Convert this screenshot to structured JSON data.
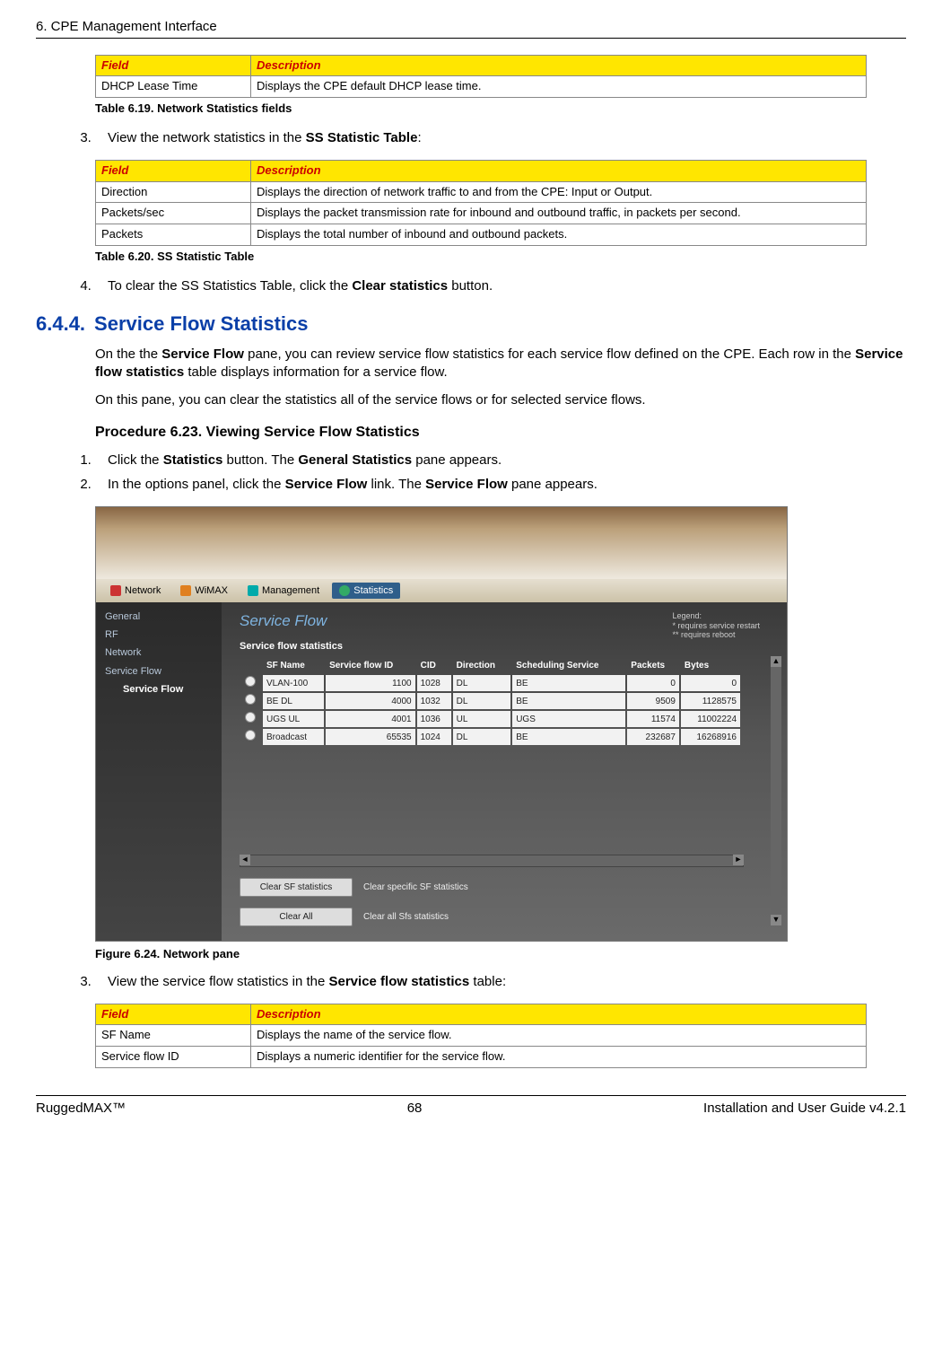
{
  "header": {
    "chapter": "6. CPE Management Interface"
  },
  "table619": {
    "h_field": "Field",
    "h_desc": "Description",
    "rows": [
      {
        "f": "DHCP Lease Time",
        "d": "Displays the CPE default DHCP lease time."
      }
    ],
    "caption": "Table 6.19. Network Statistics fields"
  },
  "step3": {
    "pre": "View the network statistics in the ",
    "bold": "SS Statistic Table",
    "post": ":"
  },
  "table620": {
    "h_field": "Field",
    "h_desc": "Description",
    "rows": [
      {
        "f": "Direction",
        "d": "Displays the direction of network traffic to and from the CPE: Input or Output."
      },
      {
        "f": "Packets/sec",
        "d": "Displays the packet transmission rate for inbound and outbound traffic, in packets per second."
      },
      {
        "f": "Packets",
        "d": "Displays the total number of inbound and outbound packets."
      }
    ],
    "caption": "Table 6.20. SS Statistic Table"
  },
  "step4": {
    "pre": "To clear the SS Statistics Table, click the ",
    "bold": "Clear statistics",
    "post": " button."
  },
  "section644": {
    "num": "6.4.4.",
    "title": "Service Flow Statistics",
    "p1": {
      "t0": "On the the ",
      "b0": "Service Flow",
      "t1": " pane, you can review service flow statistics for each service flow defined on the CPE. Each row in the ",
      "b1": "Service flow statistics",
      "t2": " table displays information for a service flow."
    },
    "p2": "On this pane, you can clear the statistics all of the service flows or for selected service flows."
  },
  "proc623": {
    "title": "Procedure 6.23. Viewing Service Flow Statistics",
    "s1": {
      "t0": "Click the ",
      "b0": "Statistics",
      "t1": " button. The ",
      "b1": "General Statistics",
      "t2": " pane appears."
    },
    "s2": {
      "t0": "In the options panel, click the ",
      "b0": "Service Flow",
      "t1": " link. The ",
      "b1": "Service Flow",
      "t2": " pane appears."
    },
    "s3": {
      "t0": "View the service flow statistics in the ",
      "b0": "Service flow statistics",
      "t1": " table:"
    }
  },
  "screenshot": {
    "tabs": {
      "network": "Network",
      "wimax": "WiMAX",
      "management": "Management",
      "statistics": "Statistics"
    },
    "side": {
      "general": "General",
      "rf": "RF",
      "network": "Network",
      "sf": "Service Flow",
      "sf_active": "Service Flow"
    },
    "title": "Service Flow",
    "legend": {
      "l0": "Legend:",
      "l1": "*  requires service restart",
      "l2": "** requires reboot"
    },
    "subhead": "Service flow statistics",
    "cols": {
      "sfname": "SF Name",
      "sfid": "Service flow ID",
      "cid": "CID",
      "dir": "Direction",
      "sched": "Scheduling Service",
      "packets": "Packets",
      "bytes": "Bytes"
    },
    "rows": [
      {
        "name": "VLAN-100",
        "sfid": "1100",
        "cid": "1028",
        "dir": "DL",
        "sched": "BE",
        "packets": "0",
        "bytes": "0"
      },
      {
        "name": "BE DL",
        "sfid": "4000",
        "cid": "1032",
        "dir": "DL",
        "sched": "BE",
        "packets": "9509",
        "bytes": "1128575"
      },
      {
        "name": "UGS UL",
        "sfid": "4001",
        "cid": "1036",
        "dir": "UL",
        "sched": "UGS",
        "packets": "11574",
        "bytes": "11002224"
      },
      {
        "name": "Broadcast",
        "sfid": "65535",
        "cid": "1024",
        "dir": "DL",
        "sched": "BE",
        "packets": "232687",
        "bytes": "16268916"
      }
    ],
    "btn1": "Clear SF statistics",
    "btn1label": "Clear specific SF statistics",
    "btn2": "Clear All",
    "btn2label": "Clear all Sfs statistics"
  },
  "figcap": "Figure 6.24. Network pane",
  "table621prefix": {
    "h_field": "Field",
    "h_desc": "Description",
    "rows": [
      {
        "f": "SF Name",
        "d": "Displays the name of the service flow."
      },
      {
        "f": "Service flow ID",
        "d": "Displays a numeric identifier for the service flow."
      }
    ]
  },
  "footer": {
    "left": "RuggedMAX™",
    "center": "68",
    "right": "Installation and User Guide v4.2.1"
  }
}
